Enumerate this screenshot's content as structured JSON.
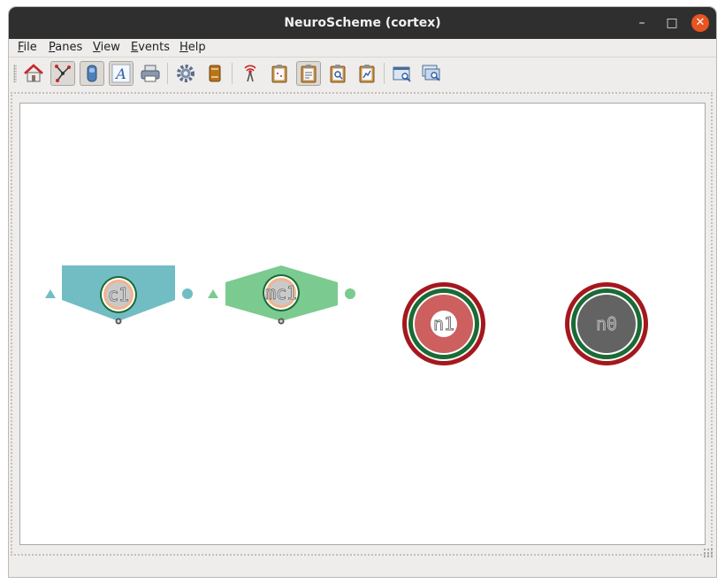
{
  "window": {
    "title": "NeuroScheme (cortex)",
    "controls": {
      "minimize": "–",
      "maximize": "□",
      "close": "✕"
    }
  },
  "menu": {
    "file": {
      "mnemonic": "F",
      "rest": "ile"
    },
    "panes": {
      "mnemonic": "P",
      "rest": "anes"
    },
    "view": {
      "mnemonic": "V",
      "rest": "iew"
    },
    "events": {
      "mnemonic": "E",
      "rest": "vents"
    },
    "help": {
      "mnemonic": "H",
      "rest": "elp"
    }
  },
  "toolbar": {
    "buttons": [
      {
        "name": "home-icon",
        "checked": false
      },
      {
        "name": "connections-icon",
        "checked": true
      },
      {
        "name": "layout-icon",
        "checked": true
      },
      {
        "name": "text-icon",
        "checked": true
      },
      {
        "name": "printer-icon",
        "checked": false
      },
      {
        "name": "gear-icon",
        "checked": false
      },
      {
        "name": "book-icon",
        "checked": false
      },
      {
        "name": "antenna-icon",
        "checked": false
      },
      {
        "name": "clipboard-icon",
        "checked": false
      },
      {
        "name": "clipboard-checked-icon",
        "checked": true
      },
      {
        "name": "clipboard-search-icon",
        "checked": false
      },
      {
        "name": "clipboard-chart-icon",
        "checked": false
      },
      {
        "name": "window-search-icon",
        "checked": false
      },
      {
        "name": "window-zoom-icon",
        "checked": false
      }
    ]
  },
  "scene": {
    "nodes": {
      "c1": {
        "label": "c1",
        "fill": "#72bdc4"
      },
      "mc1": {
        "label": "mc1",
        "fill": "#7bca8f"
      },
      "n1": {
        "label": "n1",
        "fill": "#cd5f5f"
      },
      "n0": {
        "label": "n0",
        "fill": "#636363"
      }
    },
    "colors": {
      "outer_ring": "#a4181d",
      "green_ring": "#1a6b35",
      "inner_core": "#c9c9c9"
    }
  }
}
